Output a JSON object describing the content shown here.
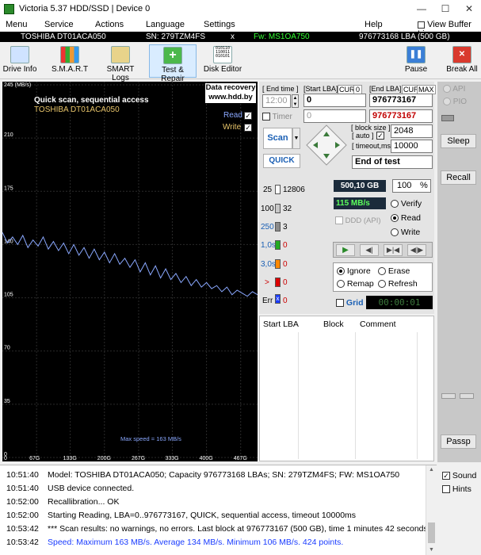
{
  "window": {
    "title": "Victoria 5.37 HDD/SSD | Device 0"
  },
  "menu": {
    "items": [
      "Menu",
      "Service",
      "Actions",
      "Language",
      "Settings",
      "Help"
    ],
    "view_buffer": "View Buffer Live"
  },
  "infobar": {
    "model": "TOSHIBA DT01ACA050",
    "serial": "SN: 279TZM4FS",
    "close": "x",
    "firmware": "Fw: MS1OA750",
    "capacity": "976773168 LBA (500 GB)"
  },
  "toolbar": {
    "buttons": [
      "Drive Info",
      "S.M.A.R.T",
      "SMART Logs",
      "Test & Repair",
      "Disk Editor"
    ],
    "pause": "Pause",
    "break_all": "Break All"
  },
  "graph": {
    "unit_label": "245 (MB/s)",
    "y_ticks": [
      "245",
      "210",
      "175",
      "140",
      "105",
      "70",
      "35",
      "0"
    ],
    "x_ticks": [
      "67G",
      "133G",
      "200G",
      "267G",
      "333G",
      "400G",
      "467G"
    ],
    "title": "Quick scan, sequential access",
    "subtitle": "TOSHIBA DT01ACA050",
    "recovery_line1": "Data recovery",
    "recovery_line2": "www.hdd.by",
    "read_label": "Read",
    "write_label": "Write",
    "max_speed": "Max speed = 163 MB/s",
    "colors": {
      "background": "#000000",
      "line": "#8aa8ff",
      "title": "#ffffff",
      "subtitle": "#e8c56a"
    }
  },
  "chart_data": {
    "type": "line",
    "xlabel": "",
    "ylabel": "MB/s",
    "ylim": [
      0,
      245
    ],
    "xlim_gb": [
      0,
      500
    ],
    "x": [
      0,
      10,
      20,
      30,
      40,
      50,
      60,
      70,
      80,
      90,
      100,
      110,
      120,
      130,
      140,
      150,
      160,
      170,
      180,
      190,
      200,
      210,
      220,
      230,
      240,
      250,
      260,
      270,
      280,
      290,
      300,
      310,
      320,
      330,
      340,
      350,
      360,
      370,
      380,
      390,
      400,
      410,
      420,
      430,
      440,
      450,
      460,
      470,
      480,
      490,
      500
    ],
    "series": [
      {
        "values": [
          148,
          141,
          145,
          140,
          146,
          138,
          143,
          139,
          145,
          137,
          142,
          136,
          141,
          134,
          140,
          133,
          138,
          131,
          137,
          130,
          135,
          128,
          134,
          127,
          131,
          125,
          130,
          122,
          128,
          120,
          126,
          118,
          124,
          117,
          121,
          115,
          119,
          113,
          117,
          112,
          115,
          111,
          113,
          109,
          112,
          107,
          110,
          108,
          106,
          109,
          107
        ]
      }
    ]
  },
  "controls": {
    "end_time_label": "[ End time ]",
    "end_time_value": "12:00",
    "timer_label": "Timer",
    "timer_value": "0",
    "start_lba_label": "[Start LBA]",
    "cur_label": "CUR",
    "cur_zero": "0",
    "start_lba": "0",
    "end_lba_label": "[End LBA]",
    "max_label": "MAX",
    "end_lba_max": "976773167",
    "end_lba": "976773167",
    "scan_button": "Scan",
    "quick_button": "QUICK",
    "block_size_label": "[ block size ]",
    "auto_label": "[ auto ]",
    "timeout_label": "[ timeout,ms ]",
    "block_size": "2048",
    "timeout": "10000",
    "end_mode": "End of test"
  },
  "stats": {
    "rows": [
      {
        "threshold": "25",
        "count": "12806",
        "color": "#ffffff"
      },
      {
        "threshold": "100",
        "count": "32",
        "color": "#c8c8c8"
      },
      {
        "threshold": "250",
        "count": "3",
        "color": "#8a8a8a"
      },
      {
        "threshold": "1,0s",
        "count": "0",
        "color": "#22aa22"
      },
      {
        "threshold": "3,0s",
        "count": "0",
        "color": "#ff8800"
      },
      {
        "threshold": ">",
        "count": "0",
        "color": "#dd0000"
      },
      {
        "threshold": "Err",
        "count": "0",
        "color": "#1a3cff"
      }
    ],
    "size_value": "500,10 GB",
    "percent": "100",
    "percent_sign": "%",
    "speed": "115 MB/s",
    "ddd_label": "DDD (API)",
    "modes": [
      "Verify",
      "Read",
      "Write"
    ],
    "actions": [
      "Ignore",
      "Erase",
      "Remap",
      "Refresh"
    ],
    "grid_label": "Grid",
    "timer_display": "00:00:01"
  },
  "table": {
    "columns": [
      "Start LBA",
      "Block",
      "Comment"
    ]
  },
  "right_panel": {
    "api": "API",
    "pio": "PIO",
    "sleep": "Sleep",
    "recall": "Recall",
    "passp": "Passp"
  },
  "log": {
    "rows": [
      {
        "time": "10:51:40",
        "text": "Model: TOSHIBA DT01ACA050; Capacity 976773168 LBAs; SN: 279TZM4FS; FW: MS1OA750",
        "color": "#000000"
      },
      {
        "time": "10:51:40",
        "text": "USB device connected.",
        "color": "#000000"
      },
      {
        "time": "10:52:00",
        "text": "Recallibration... OK",
        "color": "#000000"
      },
      {
        "time": "10:52:00",
        "text": "Starting Reading, LBA=0..976773167, QUICK, sequential access, timeout 10000ms",
        "color": "#000000"
      },
      {
        "time": "10:53:42",
        "text": "*** Scan results: no warnings, no errors. Last block at 976773167 (500 GB), time 1 minutes 42 seconds.",
        "color": "#000000"
      },
      {
        "time": "10:53:42",
        "text": "Speed: Maximum 163 MB/s. Average 134 MB/s. Minimum 106 MB/s. 424 points.",
        "color": "#1a3cff"
      }
    ],
    "sound_label": "Sound",
    "hints_label": "Hints"
  }
}
